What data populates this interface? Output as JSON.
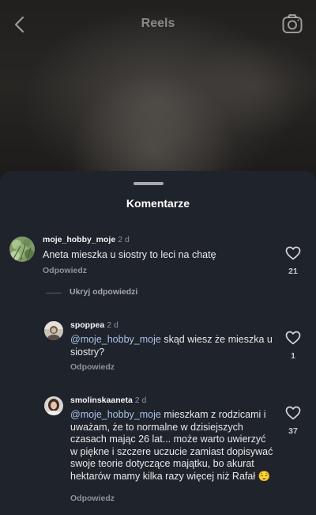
{
  "header": {
    "title": "Reels",
    "back_icon": "chevron-left-icon",
    "camera_icon": "camera-icon"
  },
  "sheet": {
    "title": "Komentarze"
  },
  "comments": [
    {
      "username": "moje_hobby_moje",
      "time": "2 d",
      "mention": "",
      "text": "Aneta mieszka u siostry to leci na chatę",
      "reply_label": "Odpowiedz",
      "likes": "21",
      "avatar_icon": "plant-avatar"
    },
    {
      "username": "spoppea",
      "time": "2 d",
      "mention": "@moje_hobby_moje",
      "text": " skąd wiesz że mieszka u siostry?",
      "reply_label": "Odpowiedz",
      "likes": "1",
      "avatar_icon": "person-avatar"
    },
    {
      "username": "smolinskaaneta",
      "time": "2 d",
      "mention": "@moje_hobby_moje",
      "text": " mieszkam z rodzicami i uważam, że to normalne w dzisiejszych czasach mając 26 lat... może warto uwierzyć w piękne i szczere uczucie zamiast dopisywać swoje teorie dotyczące majątku, bo akurat hektarów mamy kilka razy więcej niż Rafał 😌",
      "reply_label": "Odpowiedz",
      "likes": "37",
      "avatar_icon": "person-avatar"
    }
  ],
  "hide_replies_label": "Ukryj odpowiedzi",
  "colors": {
    "sheet_bg": "#1f232b",
    "mention": "#a9c3e6",
    "muted": "#8e9299"
  }
}
